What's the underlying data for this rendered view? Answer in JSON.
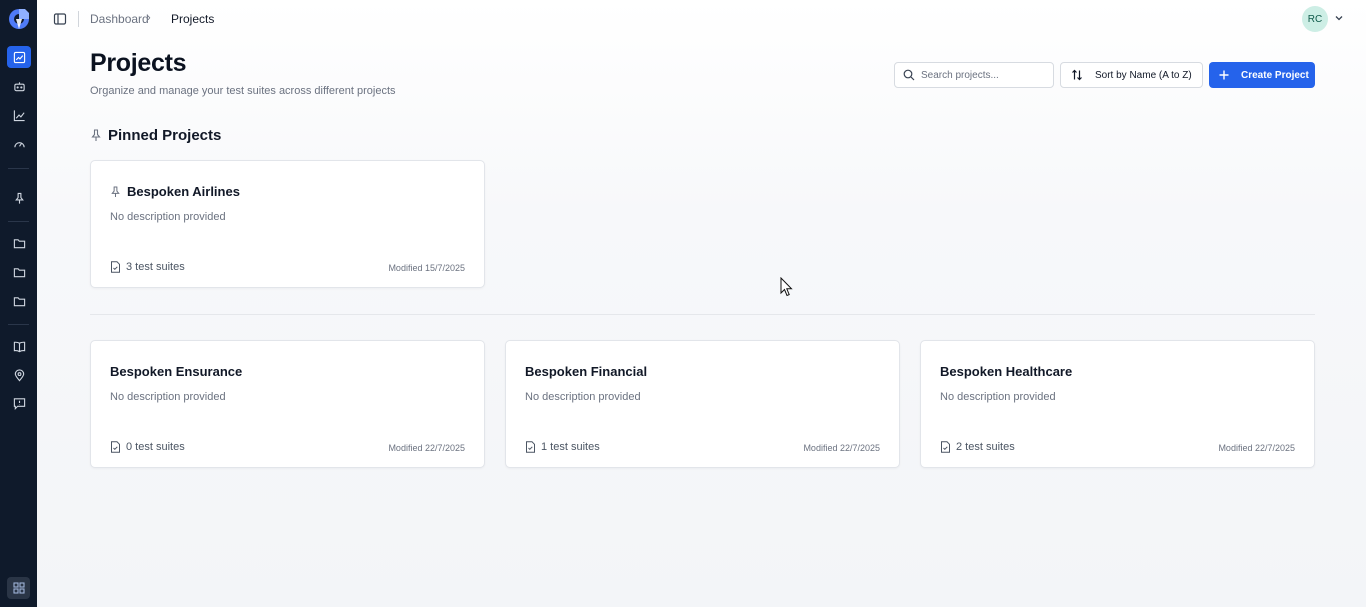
{
  "breadcrumb": {
    "items": [
      "Dashboard",
      "Projects"
    ]
  },
  "user": {
    "initials": "RC"
  },
  "header": {
    "title": "Projects",
    "subtitle": "Organize and manage your test suites across different projects"
  },
  "toolbar": {
    "search_placeholder": "Search projects...",
    "sort_label": "Sort by Name (A to Z)",
    "create_label": "Create Project"
  },
  "pinned": {
    "title": "Pinned Projects",
    "projects": [
      {
        "name": "Bespoken Airlines",
        "description": "No description provided",
        "suites": "3 test suites",
        "modified": "Modified 15/7/2025"
      }
    ]
  },
  "projects": [
    {
      "name": "Bespoken Ensurance",
      "description": "No description provided",
      "suites": "0 test suites",
      "modified": "Modified 22/7/2025"
    },
    {
      "name": "Bespoken Financial",
      "description": "No description provided",
      "suites": "1 test suites",
      "modified": "Modified 22/7/2025"
    },
    {
      "name": "Bespoken Healthcare",
      "description": "No description provided",
      "suites": "2 test suites",
      "modified": "Modified 22/7/2025"
    }
  ],
  "sidebar": {
    "icons": [
      "projects-icon",
      "robot-icon",
      "analytics-icon",
      "gauge-icon",
      "pin-icon",
      "folder-icon",
      "folder-icon",
      "folder-icon",
      "book-icon",
      "location-icon",
      "feedback-icon",
      "apps-grid-icon"
    ]
  },
  "colors": {
    "sidebar": "#0f1a2b",
    "accent": "#2563eb",
    "avatar": "#cdeee5"
  }
}
